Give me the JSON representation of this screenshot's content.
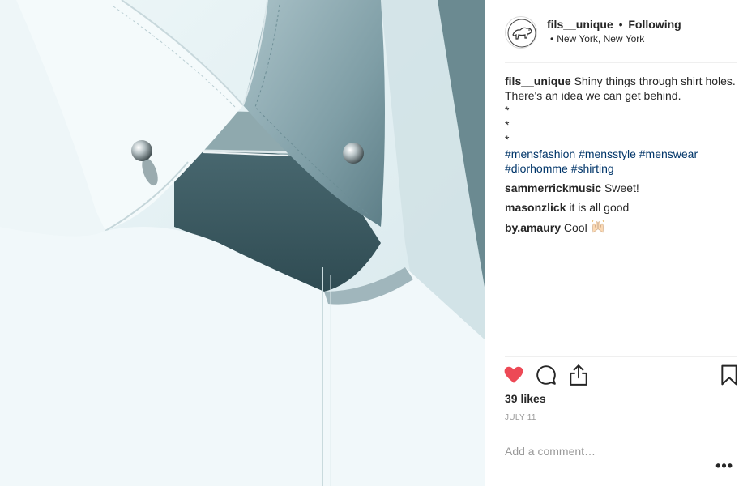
{
  "post": {
    "username": "fils__unique",
    "separator": "•",
    "follow_status": "Following",
    "location_dot": "•",
    "location": "New York, New York",
    "avatar_icon": "leopard-logo-icon"
  },
  "caption": {
    "username": "fils__unique",
    "text": "Shiny things through shirt holes. There's an idea we can get behind.",
    "stars": [
      "*",
      "*",
      "*"
    ],
    "hashtags": [
      "#mensfashion",
      "#mensstyle",
      "#menswear",
      "#diorhomme",
      "#shirting"
    ]
  },
  "comments": [
    {
      "username": "sammerrickmusic",
      "text": "Sweet!"
    },
    {
      "username": "masonzlick",
      "text": "it is all good"
    },
    {
      "username": "by.amaury",
      "text": "Cool",
      "emoji": "raised-hands-icon"
    }
  ],
  "actions": {
    "like_icon": "heart-filled-icon",
    "comment_icon": "comment-bubble-icon",
    "share_icon": "share-upload-icon",
    "save_icon": "bookmark-icon",
    "like_color": "#ed4956"
  },
  "likes": "39 likes",
  "date": "JULY 11",
  "comment_input": {
    "placeholder": "Add a comment…",
    "value": ""
  },
  "more_label": "•••"
}
